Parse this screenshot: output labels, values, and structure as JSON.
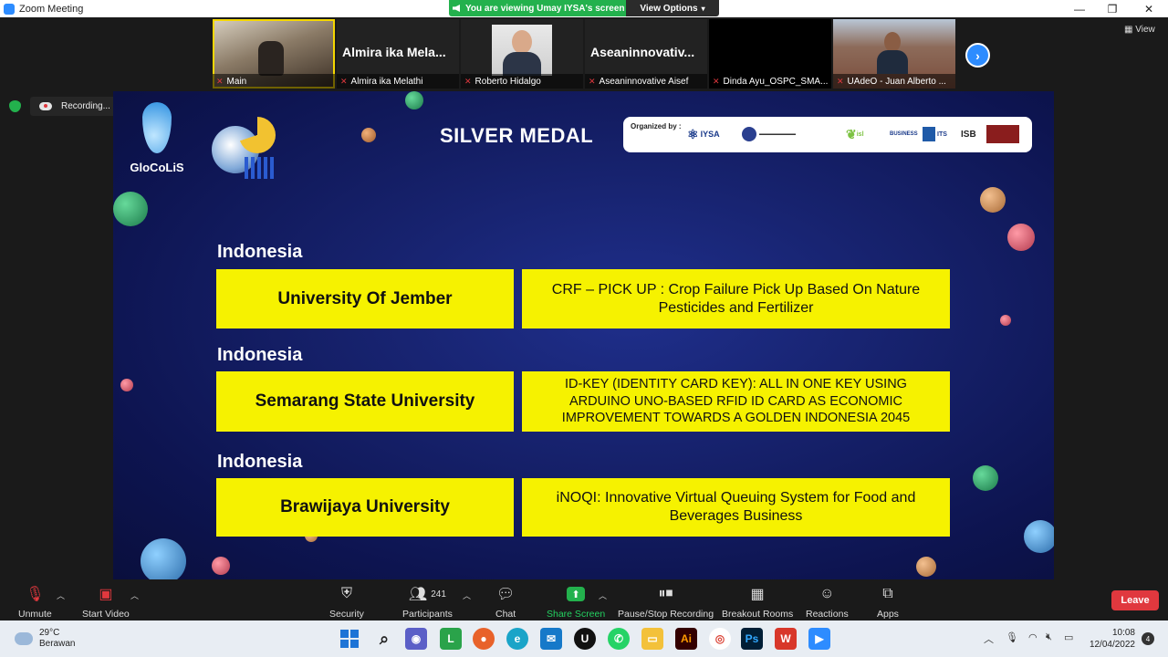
{
  "window": {
    "title": "Zoom Meeting",
    "viewing_banner": "You are viewing Umay IYSA's screen",
    "view_options": "View Options"
  },
  "participants": [
    {
      "name": "Main",
      "big_name": ""
    },
    {
      "name": "Almira ika Melathi",
      "big_name": "Almira ika Mela..."
    },
    {
      "name": "Roberto Hidalgo",
      "big_name": ""
    },
    {
      "name": "Aseaninnovative Aisef",
      "big_name": "Aseaninnovativ..."
    },
    {
      "name": "Dinda Ayu_OSPC_SMA...",
      "big_name": ""
    },
    {
      "name": "UAdeO - Juan Alberto ...",
      "big_name": ""
    }
  ],
  "view_label": "View",
  "recording": {
    "label": "Recording..."
  },
  "slide": {
    "logo_text": "GloCoLiS",
    "title": "SILVER MEDAL",
    "organized_by": "Organized by :",
    "org_logos": [
      "IYSA",
      "ISB",
      "BUSINESS",
      "ITS"
    ],
    "awards": [
      {
        "country": "Indonesia",
        "university": "University Of Jember",
        "project": "CRF – PICK UP : Crop Failure Pick Up Based On Nature Pesticides and Fertilizer"
      },
      {
        "country": "Indonesia",
        "university": "Semarang State University",
        "project": "ID-KEY (IDENTITY CARD KEY): ALL IN ONE KEY USING ARDUINO UNO-BASED RFID ID CARD AS ECONOMIC IMPROVEMENT TOWARDS A GOLDEN INDONESIA 2045"
      },
      {
        "country": "Indonesia",
        "university": "Brawijaya University",
        "project": "iNOQI: Innovative Virtual Queuing System for Food and Beverages Business"
      }
    ]
  },
  "toolbar": {
    "unmute": "Unmute",
    "start_video": "Start Video",
    "security": "Security",
    "participants": "Participants",
    "participant_count": "241",
    "chat": "Chat",
    "share_screen": "Share Screen",
    "pause_stop_recording": "Pause/Stop Recording",
    "breakout_rooms": "Breakout Rooms",
    "reactions": "Reactions",
    "apps": "Apps",
    "leave": "Leave"
  },
  "taskbar": {
    "temperature": "29°C",
    "weather": "Berawan",
    "time": "10:08",
    "date": "12/04/2022",
    "notification_count": "4"
  },
  "colors": {
    "zoom_blue": "#2d8cff",
    "banner_green": "#23b14d",
    "leave_red": "#e0383e",
    "award_yellow": "#f6f200",
    "slide_navy": "#16216b"
  }
}
